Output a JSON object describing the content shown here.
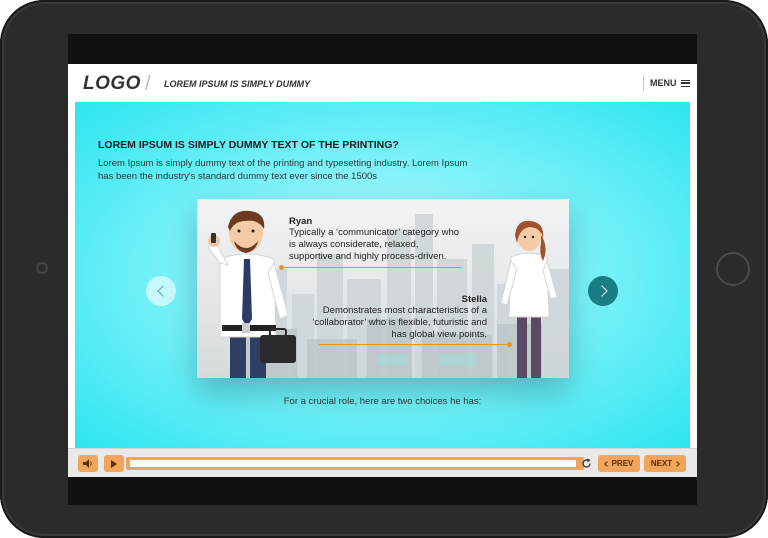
{
  "header": {
    "logo": "LOGO",
    "course_title": "LOREM IPSUM IS SIMPLY DUMMY",
    "menu_label": "MENU",
    "menu_icon": "hamburger-icon"
  },
  "slide": {
    "heading": "LOREM IPSUM IS SIMPLY DUMMY TEXT OF THE PRINTING?",
    "intro": "Lorem Ipsum is simply dummy text of the printing and typesetting industry. Lorem Ipsum has been the industry's standard dummy text ever since the 1500s",
    "characters": [
      {
        "name": "Ryan",
        "description": "Typically a ‘communicator’ category who is always considerate, relaxed, supportive and highly process-driven."
      },
      {
        "name": "Stella",
        "description": "Demonstrates most characteristics of a ‘collaborator’ who is flexible, futuristic and has global view points."
      }
    ],
    "caption": "For a crucial role, here are two choices he has:",
    "nav_prev_icon": "chevron-left-icon",
    "nav_next_icon": "chevron-right-icon"
  },
  "controls": {
    "audio_icon": "speaker-icon",
    "play_icon": "play-icon",
    "reload_icon": "reload-icon",
    "prev_label": "PREV",
    "next_label": "NEXT",
    "progress": 0.0
  },
  "colors": {
    "accent": "#f0a55a",
    "content_bg": "#2ce5f0",
    "nav_next_bg": "#1a7e86",
    "highlight_line": "#e8922c"
  }
}
